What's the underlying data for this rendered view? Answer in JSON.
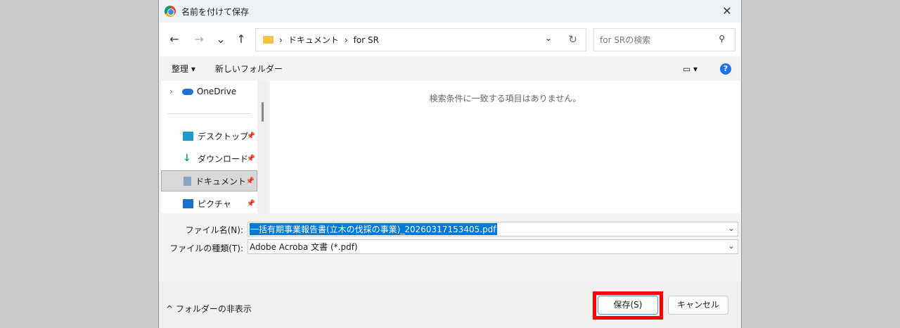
{
  "window": {
    "title": "名前を付けて保存",
    "close": "✕"
  },
  "nav": {
    "back": "←",
    "forward": "→",
    "recent": "⌄",
    "up": "↑",
    "breadcrumb": [
      "ドキュメント",
      "for SR"
    ],
    "sep": "›",
    "dropdown": "⌄",
    "refresh": "↻",
    "search_placeholder": "for SRの検索",
    "search_icon": "⚲"
  },
  "toolbar": {
    "organize": "整理 ▾",
    "new_folder": "新しいフォルダー",
    "view": "▭ ▾",
    "help": "?"
  },
  "sidebar": {
    "onedrive": "OneDrive",
    "expand": "›",
    "items": [
      {
        "label": "デスクトップ"
      },
      {
        "label": "ダウンロード"
      },
      {
        "label": "ドキュメント"
      },
      {
        "label": "ピクチャ"
      }
    ],
    "pin": "📌"
  },
  "main": {
    "empty": "検索条件に一致する項目はありません。"
  },
  "form": {
    "filename_label": "ファイル名(N):",
    "filename": "一括有期事業報告書(立木の伐採の事業)_20260317153405.pdf",
    "type_label": "ファイルの種類(T):",
    "type": "Adobe Acroba 文書 (*.pdf)",
    "chev": "⌄"
  },
  "footer": {
    "hide_folders": "^ フォルダーの非表示",
    "save": "保存(S)",
    "cancel": "キャンセル"
  },
  "colors": {
    "highlight": "#ff0000",
    "accent": "#0078d7"
  }
}
